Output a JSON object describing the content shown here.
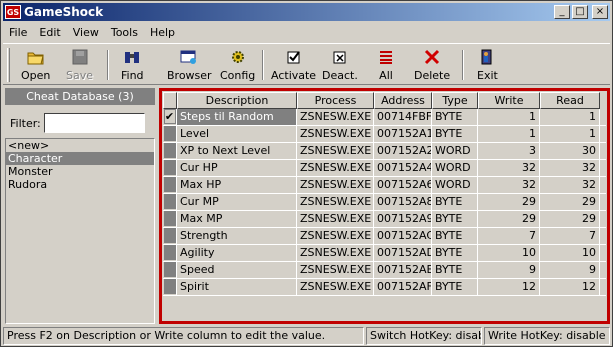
{
  "window": {
    "title": "GameShock",
    "app_icon_text": "GS",
    "controls": {
      "minimize": "_",
      "maximize": "□",
      "close": "×"
    }
  },
  "menu": [
    "File",
    "Edit",
    "View",
    "Tools",
    "Help"
  ],
  "toolbar": {
    "open": "Open",
    "save": "Save",
    "find": "Find",
    "browser": "Browser",
    "config": "Config",
    "activate": "Activate",
    "deactivate": "Deact.",
    "all": "All",
    "delete": "Delete",
    "exit": "Exit"
  },
  "left_panel": {
    "header": "Cheat Database (3)",
    "filter_label": "Filter:",
    "filter_value": "",
    "items": [
      "<new>",
      "Character",
      "Monster",
      "Rudora"
    ],
    "selected_index": 1
  },
  "grid": {
    "columns": [
      "",
      "Description",
      "Process",
      "Address",
      "Type",
      "Write",
      "Read"
    ],
    "rows": [
      {
        "checked": true,
        "description": "Steps til Random",
        "process": "ZSNESW.EXE",
        "address": "00714FBF",
        "type": "BYTE",
        "write": "1",
        "read": "1"
      },
      {
        "checked": false,
        "description": "Level",
        "process": "ZSNESW.EXE",
        "address": "007152A1",
        "type": "BYTE",
        "write": "1",
        "read": "1"
      },
      {
        "checked": false,
        "description": "XP to Next Level",
        "process": "ZSNESW.EXE",
        "address": "007152A2",
        "type": "WORD",
        "write": "3",
        "read": "30"
      },
      {
        "checked": false,
        "description": "Cur HP",
        "process": "ZSNESW.EXE",
        "address": "007152A4",
        "type": "WORD",
        "write": "32",
        "read": "32"
      },
      {
        "checked": false,
        "description": "Max HP",
        "process": "ZSNESW.EXE",
        "address": "007152A6",
        "type": "WORD",
        "write": "32",
        "read": "32"
      },
      {
        "checked": false,
        "description": "Cur MP",
        "process": "ZSNESW.EXE",
        "address": "007152A8",
        "type": "BYTE",
        "write": "29",
        "read": "29"
      },
      {
        "checked": false,
        "description": "Max MP",
        "process": "ZSNESW.EXE",
        "address": "007152A9",
        "type": "BYTE",
        "write": "29",
        "read": "29"
      },
      {
        "checked": false,
        "description": "Strength",
        "process": "ZSNESW.EXE",
        "address": "007152AC",
        "type": "BYTE",
        "write": "7",
        "read": "7"
      },
      {
        "checked": false,
        "description": "Agility",
        "process": "ZSNESW.EXE",
        "address": "007152AD",
        "type": "BYTE",
        "write": "10",
        "read": "10"
      },
      {
        "checked": false,
        "description": "Speed",
        "process": "ZSNESW.EXE",
        "address": "007152AE",
        "type": "BYTE",
        "write": "9",
        "read": "9"
      },
      {
        "checked": false,
        "description": "Spirit",
        "process": "ZSNESW.EXE",
        "address": "007152AF",
        "type": "BYTE",
        "write": "12",
        "read": "12"
      }
    ]
  },
  "status": {
    "hint": "Press F2 on Description or Write column to edit the value.",
    "switch_hotkey": "Switch HotKey: disable",
    "write_hotkey": "Write HotKey: disable"
  }
}
